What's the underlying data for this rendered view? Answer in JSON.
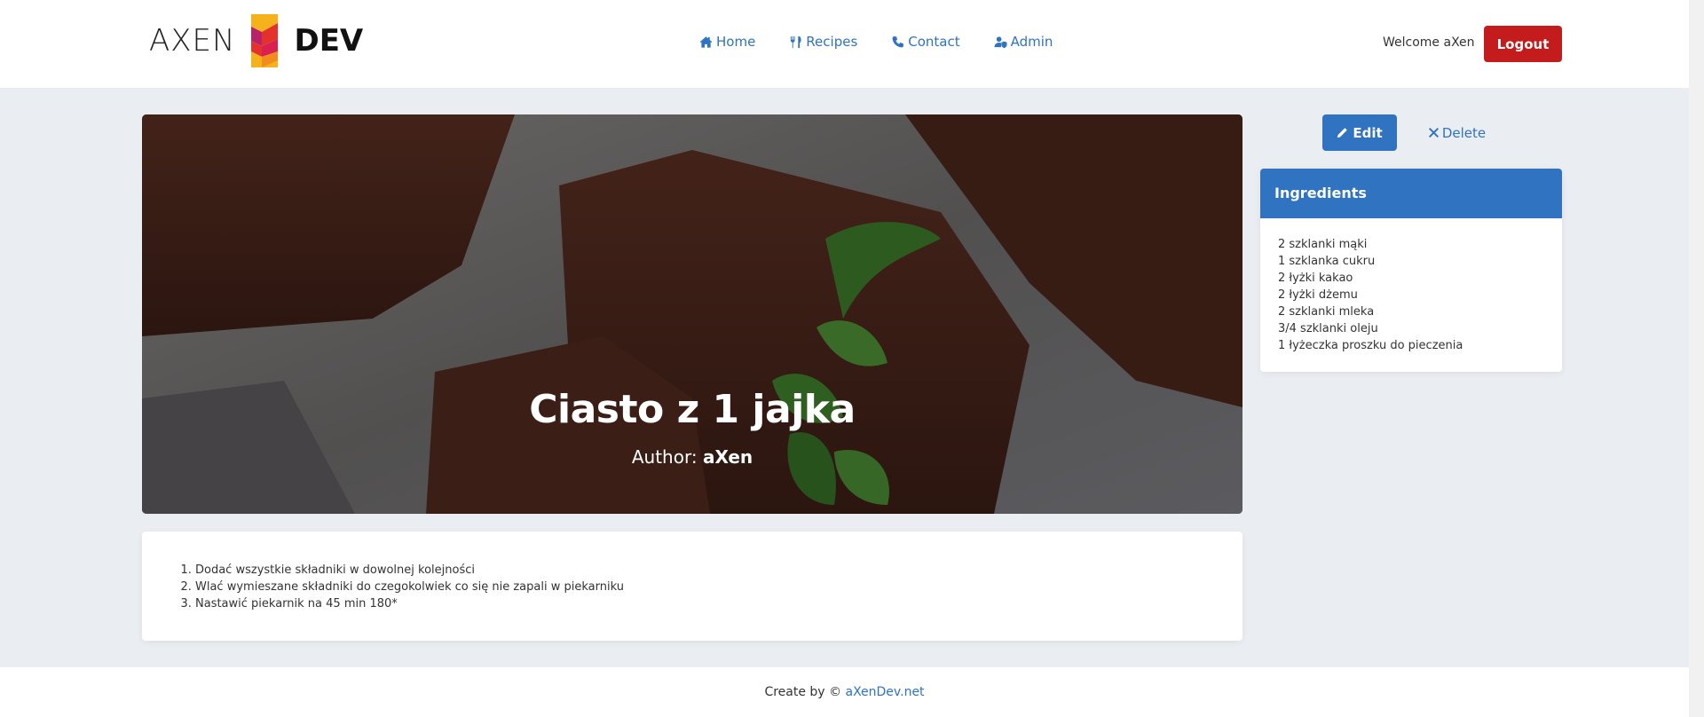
{
  "header": {
    "logo_left": "AXEN",
    "logo_right": "DEV",
    "nav": [
      {
        "label": "Home",
        "icon": "home-icon"
      },
      {
        "label": "Recipes",
        "icon": "utensils-icon"
      },
      {
        "label": "Contact",
        "icon": "phone-icon"
      },
      {
        "label": "Admin",
        "icon": "user-shield-icon"
      }
    ],
    "welcome": "Welcome aXen",
    "logout": "Logout"
  },
  "recipe": {
    "title": "Ciasto z 1 jajka",
    "author_label": "Author:",
    "author": "aXen",
    "steps": [
      "Dodać wszystkie składniki w dowolnej kolejności",
      "Wlać wymieszane składniki do czegokolwiek co się nie zapali w piekarniku",
      "Nastawić piekarnik na 45 min 180*"
    ]
  },
  "actions": {
    "edit": "Edit",
    "delete": "Delete"
  },
  "ingredients": {
    "title": "Ingredients",
    "items": [
      "2 szklanki mąki",
      "1 szklanka cukru",
      "2 łyżki kakao",
      "2 łyżki dżemu",
      "2 szklanki mleka",
      "3/4 szklanki oleju",
      "1 łyżeczka proszku do pieczenia"
    ]
  },
  "footer": {
    "prefix": "Create by ©",
    "link": "aXenDev.net"
  },
  "colors": {
    "accent": "#2f73c1",
    "danger": "#c41c1c",
    "background": "#eaedf1"
  }
}
